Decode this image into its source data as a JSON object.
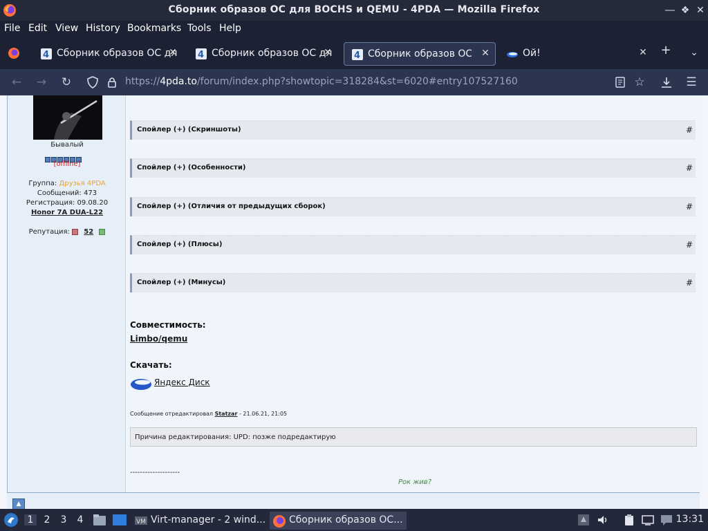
{
  "window": {
    "title": "Сборник образов ОС для BOCHS и QEMU - 4PDA — Mozilla Firefox"
  },
  "menu": {
    "items": [
      {
        "label": "File",
        "key": "F"
      },
      {
        "label": "Edit",
        "key": "E"
      },
      {
        "label": "View",
        "key": "V"
      },
      {
        "label": "History",
        "key": "H"
      },
      {
        "label": "Bookmarks",
        "key": "B"
      },
      {
        "label": "Tools",
        "key": "T"
      },
      {
        "label": "Help",
        "key": "H"
      }
    ]
  },
  "tabs": [
    {
      "label": "Сборник образов ОС дл",
      "icon": "4pda-icon",
      "active": false
    },
    {
      "label": "Сборник образов ОС дл",
      "icon": "4pda-icon",
      "active": false
    },
    {
      "label": "Сборник образов ОС дл",
      "icon": "4pda-icon",
      "active": true
    },
    {
      "label": "Ой!",
      "icon": "yandex-disk-icon",
      "active": false
    }
  ],
  "nav": {
    "url_scheme": "https://",
    "url_host": "4pda.to",
    "url_path": "/forum/index.php?showtopic=318284&st=6020#entry107527160"
  },
  "user": {
    "rank": "Бывалый",
    "status": "[offline]",
    "group_label": "Группа:",
    "group_value": "Друзья 4PDA",
    "posts": "Сообщений: 473",
    "registered": "Регистрация: 09.08.20",
    "device": "Honor 7A DUA-L22",
    "reputation_label": "Репутация:",
    "reputation_value": "52",
    "rank_pips": 6
  },
  "post": {
    "spoilers": [
      "Спойлер (+) (Скриншоты)",
      "Спойлер (+) (Особенности)",
      "Спойлер (+) (Отличия от предыдущих сборок)",
      "Спойлер (+) (Плюсы)",
      "Спойлер (+) (Минусы)"
    ],
    "spoiler_hash": "#",
    "compat_heading": "Совместимость:",
    "compat_link": "Limbo/qemu",
    "download_heading": "Скачать:",
    "download_link": "Яндекс Диск",
    "edited_prefix": "Сообщение отредактировал",
    "edited_user": "Statzar",
    "edited_suffix": "- 21.06.21, 21:05",
    "edit_reason": "Причина редактирования: UPD: позже подредактирую",
    "signature_line": "--------------------",
    "signature_text": "Рок жив?"
  },
  "taskbar": {
    "workspaces": [
      "1",
      "2",
      "3",
      "4"
    ],
    "tasks": [
      {
        "label": "Virt-manager - 2 wind...",
        "active": false
      },
      {
        "label": "Сборник образов ОС...",
        "active": true
      }
    ],
    "clock": "13:31"
  },
  "colors": {
    "titlebar": "#252a3a",
    "toolbar": "#1c2233",
    "navbar": "#2b3550",
    "group": "#e8a33a",
    "offline": "#cc2222"
  }
}
